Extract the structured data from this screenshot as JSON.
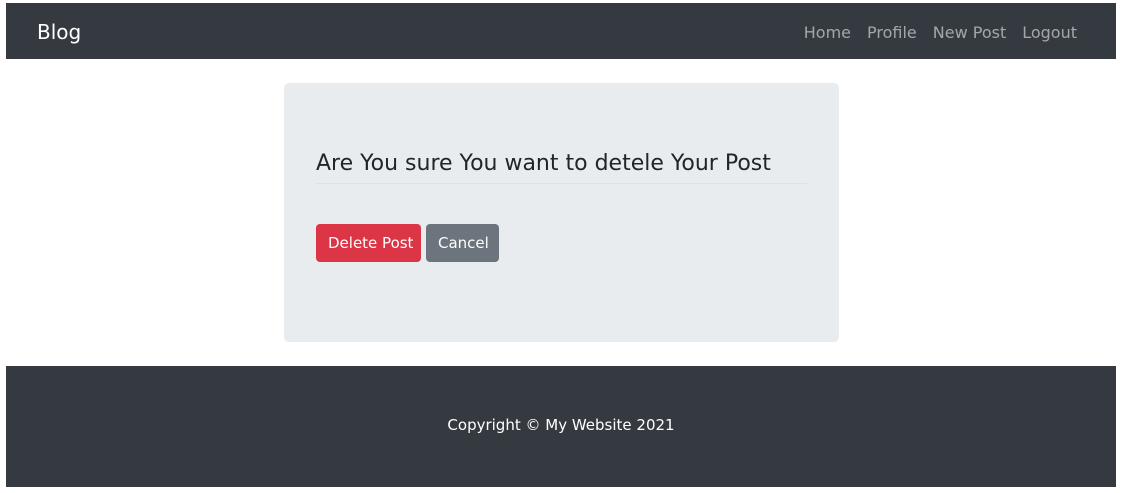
{
  "navbar": {
    "brand": "Blog",
    "links": [
      {
        "label": "Home"
      },
      {
        "label": "Profile"
      },
      {
        "label": "New Post"
      },
      {
        "label": "Logout"
      }
    ]
  },
  "dialog": {
    "title": "Are You sure You want to detele Your Post",
    "delete_label": "Delete Post",
    "cancel_label": "Cancel"
  },
  "footer": {
    "text": "Copyright © My Website 2021"
  },
  "colors": {
    "navbar_bg": "#343a40",
    "card_bg": "#e9ecef",
    "danger": "#dc3545",
    "secondary": "#6c757d"
  }
}
